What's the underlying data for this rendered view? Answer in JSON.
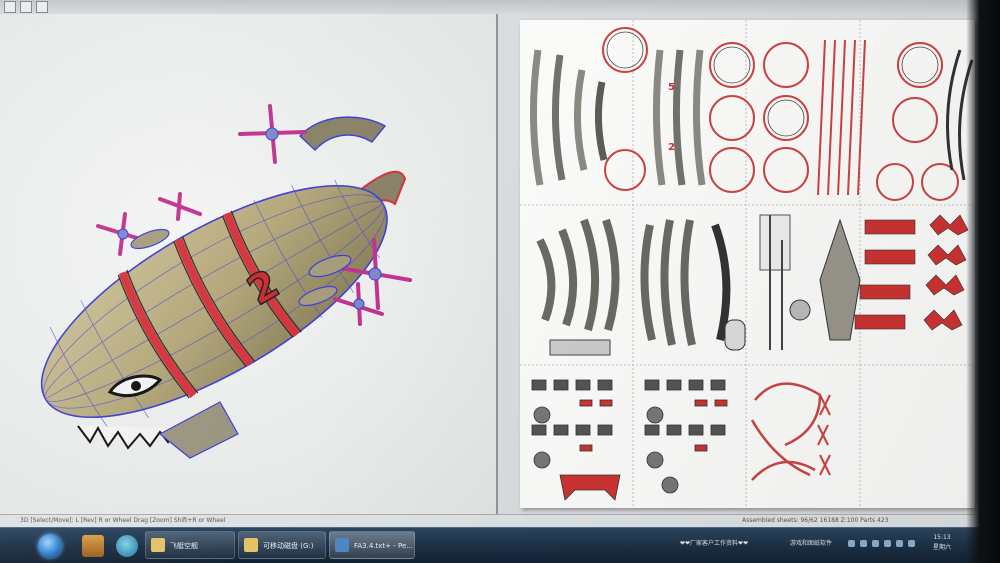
{
  "statusbar": {
    "left_text": "3D [Select/Move]: L [Rev] R or Wheel Drag [Zoom] Shift+R or Wheel",
    "right_text": "Assembled sheets: 96/62 16188 Z:100 Parts 423"
  },
  "taskbar": {
    "buttons": [
      {
        "label": "飞艇空舰"
      },
      {
        "label": "可移动磁盘 (G:)"
      },
      {
        "label": "FA3.4.txt+ - Pe..."
      }
    ],
    "tray_text_1": "❤❤厂家客户工作资料❤❤",
    "tray_text_2": "游戏和图纸软件",
    "clock_time": "15:13",
    "clock_day": "星期六"
  },
  "model": {
    "number_decal": "2"
  },
  "colors": {
    "accent_red": "#d5333d",
    "hull_tan": "#b9ad83",
    "wire_blue": "#3b3fd6",
    "taskbar": "#1b2f44"
  },
  "icons": [
    "start-orb-icon",
    "folder-icon",
    "network-icon",
    "windows-explorer-icon",
    "pepakura-icon"
  ]
}
